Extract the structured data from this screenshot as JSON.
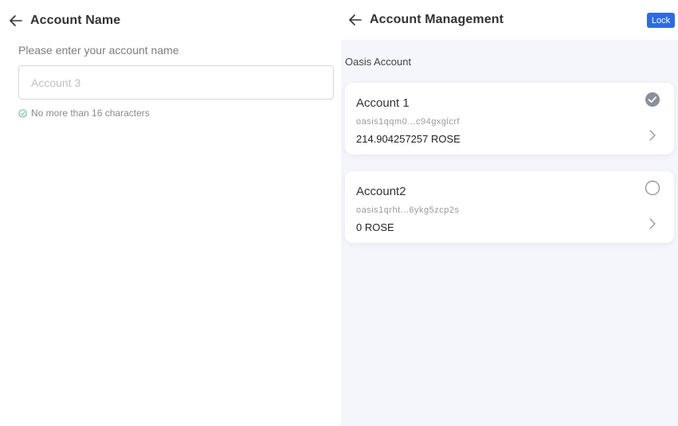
{
  "left": {
    "header": {
      "title": "Account Name"
    },
    "prompt": "Please enter your account name",
    "input": {
      "placeholder": "Account 3",
      "value": ""
    },
    "hint": "No more than 16 characters"
  },
  "right": {
    "header": {
      "title": "Account Management"
    },
    "lock_label": "Lock",
    "section_title": "Oasis Account",
    "accounts": [
      {
        "name": "Account 1",
        "address": "oasis1qqm0...c94gxglcrf",
        "balance": "214.904257257 ROSE",
        "selected": true
      },
      {
        "name": "Account2",
        "address": "oasis1qrht...6ykg5zcp2s",
        "balance": "0 ROSE",
        "selected": false
      }
    ]
  },
  "colors": {
    "accent": "#2d6be4",
    "panel_bg": "#f4f6fb",
    "hint_check": "#4caf7d",
    "selected_check": "#8a9099"
  },
  "icons": {
    "back": "arrow-left-icon",
    "check": "check-circle-icon",
    "chevron": "chevron-right-icon"
  }
}
